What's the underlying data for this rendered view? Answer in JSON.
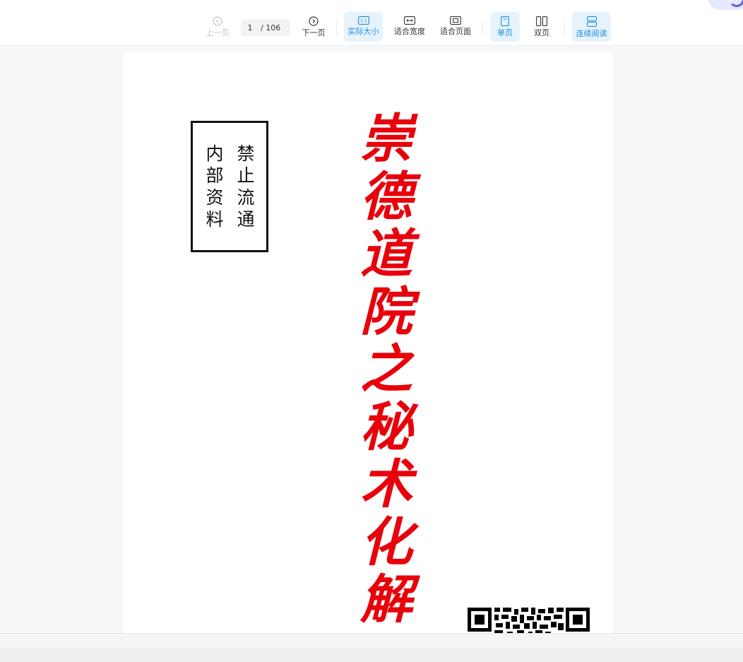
{
  "toolbar": {
    "prev_label": "上一页",
    "next_label": "下一页",
    "current_page": "1",
    "total_pages": "/ 106",
    "actual_size_label": "实际大小",
    "actual_size_icon_text": "1:1",
    "fit_width_label": "适合宽度",
    "fit_page_label": "适合页面",
    "single_page_label": "单页",
    "double_page_label": "双页",
    "continuous_label": "连续阅读",
    "icons": {
      "prev": "chevron-left-circle-icon",
      "next": "chevron-right-circle-icon",
      "actual_size": "one-to-one-icon",
      "fit_width": "fit-width-icon",
      "fit_page": "fit-page-icon",
      "single_page": "single-page-icon",
      "double_page": "double-page-icon",
      "continuous": "continuous-scroll-icon"
    },
    "active_color": "#1d8ce0"
  },
  "document": {
    "stamp_right": "禁止流通",
    "stamp_left": "内部资料",
    "title": "崇德道院之秘术化解",
    "title_color": "#e8000b"
  }
}
